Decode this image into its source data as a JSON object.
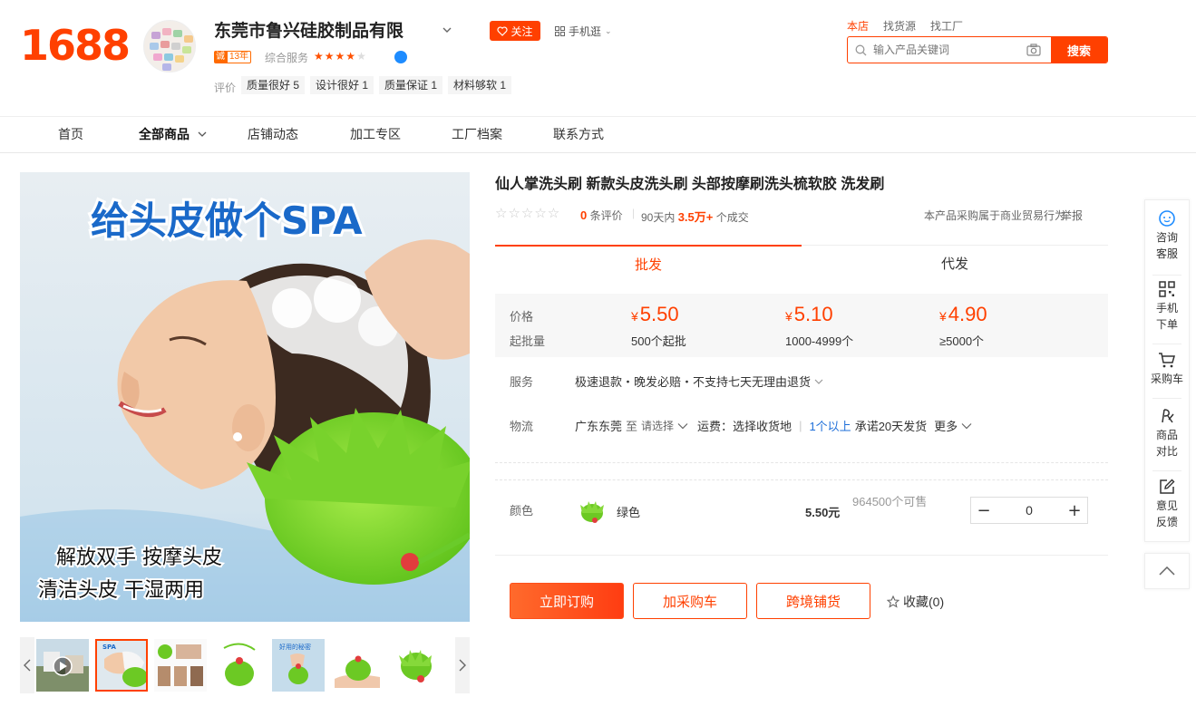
{
  "header": {
    "logo": "1688",
    "shop_name": "东莞市鲁兴硅胶制品有限",
    "follow_label": "关注",
    "mobile_label": "手机逛",
    "chengxin_tag": "诚",
    "chengxin_years": "13年",
    "service_label": "综合服务",
    "service_stars": 4,
    "review_label": "评价",
    "review_tags": [
      "质量很好 5",
      "设计很好 1",
      "质量保证 1",
      "材料够软 1"
    ],
    "search_tabs": [
      "本店",
      "找货源",
      "找工厂"
    ],
    "search_placeholder": "输入产品关键词",
    "search_button": "搜索"
  },
  "nav": {
    "items": [
      "首页",
      "全部商品",
      "店铺动态",
      "加工专区",
      "工厂档案",
      "联系方式"
    ]
  },
  "gallery": {
    "headline": "给头皮做个SPA",
    "line1": "解放双手 按摩头皮",
    "line2": "清洁头皮 干湿两用",
    "thumb_label": "好用的秘密"
  },
  "product": {
    "title": "仙人掌洗头刷 新款头皮洗头刷 头部按摩刷洗头梳软胶 洗发刷",
    "rating_stars": 0,
    "eval_count": "0",
    "eval_suffix": "条评价",
    "sales_prefix": "90天内",
    "sales_value": "3.5万+",
    "sales_suffix": "个成交",
    "trade_note": "本产品采购属于商业贸易行为",
    "report": "举报"
  },
  "tabs": [
    "批发",
    "代发"
  ],
  "pricing": {
    "price_label": "价格",
    "moq_label": "起批量",
    "currency": "¥",
    "tiers": [
      {
        "price": "5.50",
        "qty": "500个起批"
      },
      {
        "price": "5.10",
        "qty": "1000-4999个"
      },
      {
        "price": "4.90",
        "qty": "≥5000个"
      }
    ]
  },
  "service": {
    "label": "服务",
    "value": "极速退款・晚发必赔・不支持七天无理由退货"
  },
  "logistics": {
    "label": "物流",
    "origin": "广东东莞",
    "to": "至",
    "dest_placeholder": "请选择",
    "freight": "运费：选择收货地",
    "qty_rule": "1个以上",
    "promise": "承诺20天发货",
    "more": "更多"
  },
  "sku": {
    "label": "颜色",
    "option": "绿色",
    "price": "5.50元",
    "stock": "964500个可售",
    "quantity": "0"
  },
  "actions": {
    "buy_now": "立即订购",
    "add_cart": "加采购车",
    "cross_border": "跨境铺货",
    "favorite": "收藏(0)"
  },
  "sidebar": {
    "items": [
      "咨询客服",
      "手机下单",
      "采购车",
      "商品对比",
      "意见反馈"
    ]
  },
  "colors": {
    "accent": "#ff4000",
    "link": "#1e6fd9",
    "price_bg": "#f7f7f7"
  }
}
